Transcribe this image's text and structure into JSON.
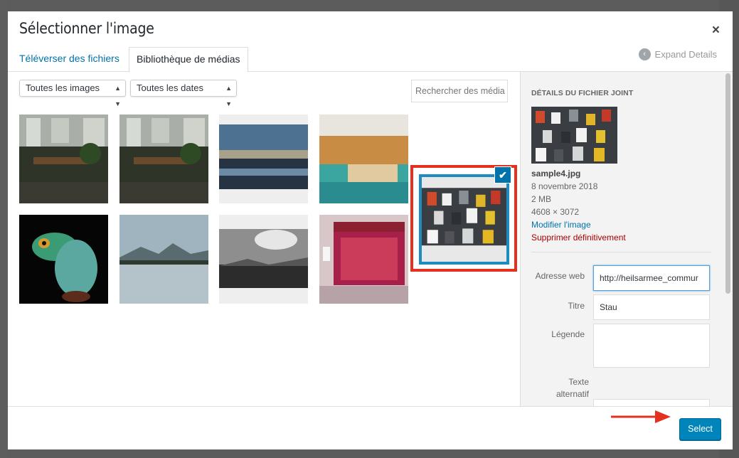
{
  "modal": {
    "title": "Sélectionner l'image",
    "close": "×"
  },
  "tabs": [
    {
      "label": "Téléverser des fichiers"
    },
    {
      "label": "Bibliothèque de médias"
    }
  ],
  "expand_details": "Expand Details",
  "filters": {
    "type": "Toutes les images",
    "date": "Toutes les dates"
  },
  "search": {
    "placeholder": "Rechercher des média"
  },
  "media": [
    {
      "name": "cafe-interior"
    },
    {
      "name": "cafe-interior-2"
    },
    {
      "name": "bridge-seascape"
    },
    {
      "name": "coastal-village"
    },
    {
      "name": "traffic-jam"
    },
    {
      "name": "frog"
    },
    {
      "name": "lake-mountains"
    },
    {
      "name": "cloudy-landscape"
    },
    {
      "name": "cinema-storefront"
    }
  ],
  "details": {
    "heading": "Détails du fichier joint",
    "filename": "sample4.jpg",
    "date": "8 novembre 2018",
    "size": "2 MB",
    "dimensions": "4608 × 3072",
    "edit_link": "Modifier l'image",
    "delete_link": "Supprimer définitivement",
    "fields": {
      "url_label": "Adresse web",
      "url_value": "http://heilsarmee_commur",
      "title_label": "Titre",
      "title_value": "Stau",
      "caption_label": "Légende",
      "caption_value": "",
      "alt_label": "Texte alternatif"
    }
  },
  "footer": {
    "select": "Select"
  },
  "colors": {
    "accent": "#0073aa",
    "primary_button": "#0085ba",
    "highlight_red": "#e3301f",
    "danger": "#a00"
  },
  "icons": {
    "close": "close-icon",
    "check": "checkmark-icon",
    "expand": "chevron-left-circle-icon",
    "dropdown": "dropdown-arrows-icon",
    "annotation": "red-arrow-icon"
  }
}
